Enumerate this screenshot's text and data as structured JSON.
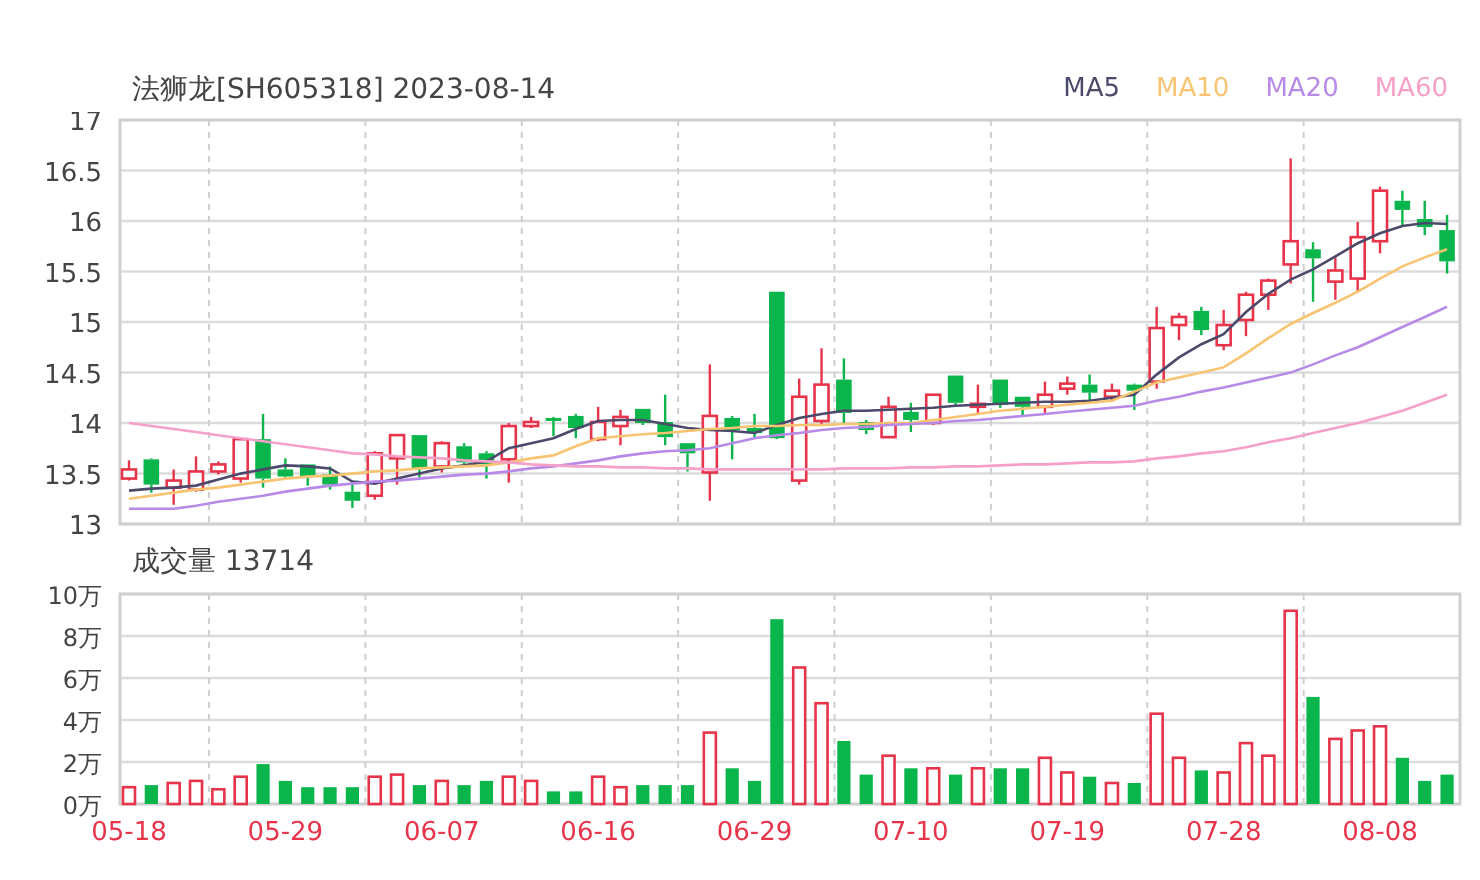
{
  "price_chart": {
    "candles": {
      "chart_data": {
        "type": "candlestick",
        "title": "法狮龙[SH605318] 2023-08-14",
        "categories": [
          null,
          null,
          null,
          null,
          null,
          null,
          null,
          null,
          null,
          null,
          null,
          null,
          null,
          null,
          null,
          null,
          null,
          null,
          null,
          null,
          null,
          null,
          null,
          null,
          null,
          null,
          null,
          null,
          null,
          null,
          null,
          null,
          null,
          null,
          null,
          null,
          null,
          null,
          null,
          null,
          null,
          null,
          null,
          null,
          null,
          null,
          null,
          null,
          null,
          null,
          null,
          null,
          null,
          null,
          null,
          null,
          null,
          null,
          null,
          null
        ],
        "grid": true,
        "ylim": [
          13,
          17
        ],
        "yticks": [
          {
            "value": 13,
            "label": "13"
          },
          {
            "value": 14,
            "label": "14"
          },
          {
            "value": 15,
            "label": "15"
          },
          {
            "value": 16,
            "label": "16"
          },
          {
            "value": 17,
            "label": "17"
          }
        ],
        "ohlc": [
          [
            13.45,
            13.63,
            13.43,
            13.54
          ],
          [
            13.64,
            13.65,
            13.31,
            13.39
          ],
          [
            13.36,
            13.54,
            13.19,
            13.43
          ],
          [
            13.34,
            13.67,
            13.32,
            13.52
          ],
          [
            13.52,
            13.62,
            13.49,
            13.59
          ],
          [
            13.45,
            13.85,
            13.41,
            13.84
          ],
          [
            13.84,
            14.09,
            13.36,
            13.45
          ],
          [
            13.54,
            13.65,
            13.45,
            13.47
          ],
          [
            13.59,
            13.59,
            13.38,
            13.47
          ],
          [
            13.49,
            13.57,
            13.34,
            13.39
          ],
          [
            13.32,
            13.43,
            13.16,
            13.23
          ],
          [
            13.28,
            13.72,
            13.24,
            13.7
          ],
          [
            13.65,
            13.88,
            13.39,
            13.88
          ],
          [
            13.88,
            13.88,
            13.46,
            13.55
          ],
          [
            13.57,
            13.82,
            13.51,
            13.8
          ],
          [
            13.77,
            13.8,
            13.57,
            13.61
          ],
          [
            13.7,
            13.72,
            13.45,
            13.59
          ],
          [
            13.64,
            14,
            13.41,
            13.97
          ],
          [
            13.97,
            14.06,
            13.95,
            14.01
          ],
          [
            14.05,
            14.06,
            13.87,
            14.03
          ],
          [
            14.07,
            14.09,
            13.85,
            13.95
          ],
          [
            13.84,
            14.16,
            13.82,
            14.01
          ],
          [
            13.97,
            14.13,
            13.78,
            14.06
          ],
          [
            14.14,
            14.14,
            13.98,
            14
          ],
          [
            14.01,
            14.28,
            13.78,
            13.86
          ],
          [
            13.8,
            13.8,
            13.52,
            13.7
          ],
          [
            13.51,
            14.58,
            13.23,
            14.07
          ],
          [
            14.05,
            14.07,
            13.64,
            13.93
          ],
          [
            13.95,
            14.09,
            13.85,
            13.9
          ],
          [
            15.3,
            15.3,
            13.84,
            13.85
          ],
          [
            13.43,
            14.44,
            13.39,
            14.26
          ],
          [
            14.02,
            14.74,
            13.99,
            14.38
          ],
          [
            14.43,
            14.64,
            14,
            14.1
          ],
          [
            14.01,
            14.03,
            13.89,
            13.93
          ],
          [
            13.86,
            14.26,
            13.85,
            14.16
          ],
          [
            14.11,
            14.2,
            13.91,
            14.03
          ],
          [
            14,
            14.28,
            13.98,
            14.28
          ],
          [
            14.47,
            14.47,
            14.16,
            14.2
          ],
          [
            14.18,
            14.38,
            14.09,
            14.19
          ],
          [
            14.43,
            14.43,
            14.15,
            14.18
          ],
          [
            14.26,
            14.26,
            14.07,
            14.16
          ],
          [
            14.16,
            14.41,
            14.09,
            14.28
          ],
          [
            14.34,
            14.46,
            14.28,
            14.39
          ],
          [
            14.38,
            14.48,
            14.2,
            14.3
          ],
          [
            14.26,
            14.39,
            14.22,
            14.32
          ],
          [
            14.38,
            14.39,
            14.13,
            14.32
          ],
          [
            14.41,
            15.15,
            14.34,
            14.94
          ],
          [
            14.97,
            15.09,
            14.82,
            15.05
          ],
          [
            15.11,
            15.15,
            14.87,
            14.92
          ],
          [
            14.77,
            15.12,
            14.72,
            14.97
          ],
          [
            15.02,
            15.3,
            14.86,
            15.27
          ],
          [
            15.27,
            15.43,
            15.12,
            15.41
          ],
          [
            15.57,
            16.62,
            15.38,
            15.8
          ],
          [
            15.72,
            15.79,
            15.2,
            15.63
          ],
          [
            15.4,
            15.64,
            15.22,
            15.51
          ],
          [
            15.43,
            15.99,
            15.3,
            15.84
          ],
          [
            15.8,
            16.34,
            15.68,
            16.3
          ],
          [
            16.2,
            16.3,
            15.95,
            16.11
          ],
          [
            16.02,
            16.2,
            15.86,
            15.94
          ],
          [
            15.91,
            16.06,
            15.48,
            15.6
          ]
        ]
      }
    },
    "moving_averages": {
      "chart_data": {
        "type": "line",
        "categories": [
          null,
          null,
          null,
          null,
          null,
          null,
          null,
          null,
          null,
          null,
          null,
          null,
          null,
          null,
          null,
          null,
          null,
          null,
          null,
          null,
          null,
          null,
          null,
          null,
          null,
          null,
          null,
          null,
          null,
          null,
          null,
          null,
          null,
          null,
          null,
          null,
          null,
          null,
          null,
          null,
          null,
          null,
          null,
          null,
          null,
          null,
          null,
          null,
          null,
          null,
          null,
          null,
          null,
          null,
          null,
          null,
          null,
          null,
          null,
          null
        ],
        "grid": true,
        "ylim": [
          13,
          17
        ],
        "yticks": [
          {
            "value": 13.5,
            "label": "13.5"
          },
          {
            "value": 14.5,
            "label": "14.5"
          },
          {
            "value": 15.5,
            "label": "15.5"
          },
          {
            "value": 16.5,
            "label": "16.5"
          }
        ],
        "series": [
          {
            "name": "MA5",
            "color": "#4b4a6b",
            "values": [
              13.33,
              13.35,
              13.36,
              13.38,
              13.44,
              13.5,
              13.54,
              13.58,
              13.57,
              13.55,
              13.42,
              13.4,
              13.45,
              13.5,
              13.55,
              13.58,
              13.62,
              13.75,
              13.8,
              13.85,
              13.94,
              14.02,
              14.03,
              14.03,
              13.99,
              13.95,
              13.93,
              13.92,
              13.9,
              13.98,
              14.05,
              14.09,
              14.12,
              14.12,
              14.13,
              14.14,
              14.15,
              14.17,
              14.18,
              14.19,
              14.2,
              14.21,
              14.21,
              14.22,
              14.25,
              14.28,
              14.48,
              14.65,
              14.78,
              14.88,
              15.1,
              15.28,
              15.42,
              15.52,
              15.65,
              15.78,
              15.88,
              15.95,
              15.98,
              15.97
            ]
          },
          {
            "name": "MA10",
            "color": "#f8c471",
            "values": [
              13.25,
              13.28,
              13.31,
              13.34,
              13.36,
              13.39,
              13.42,
              13.45,
              13.47,
              13.48,
              13.5,
              13.52,
              13.53,
              13.55,
              13.56,
              13.57,
              13.58,
              13.61,
              13.65,
              13.68,
              13.77,
              13.85,
              13.87,
              13.89,
              13.9,
              13.92,
              13.94,
              13.95,
              13.97,
              13.97,
              13.98,
              13.98,
              13.99,
              13.99,
              14,
              14,
              14.03,
              14.06,
              14.09,
              14.12,
              14.14,
              14.16,
              14.18,
              14.2,
              14.22,
              14.31,
              14.4,
              14.45,
              14.5,
              14.55,
              14.69,
              14.84,
              14.98,
              15.09,
              15.19,
              15.3,
              15.43,
              15.55,
              15.64,
              15.72
            ]
          },
          {
            "name": "MA20",
            "color": "#b88ae8",
            "values": [
              13.15,
              13.15,
              13.15,
              13.18,
              13.22,
              13.25,
              13.28,
              13.32,
              13.35,
              13.38,
              13.4,
              13.42,
              13.43,
              13.45,
              13.47,
              13.49,
              13.5,
              13.52,
              13.55,
              13.57,
              13.6,
              13.63,
              13.67,
              13.7,
              13.72,
              13.73,
              13.75,
              13.8,
              13.85,
              13.88,
              13.9,
              13.93,
              13.95,
              13.96,
              13.98,
              13.99,
              14,
              14.02,
              14.03,
              14.05,
              14.07,
              14.09,
              14.11,
              14.13,
              14.15,
              14.17,
              14.22,
              14.26,
              14.31,
              14.35,
              14.4,
              14.45,
              14.5,
              14.58,
              14.67,
              14.75,
              14.85,
              14.95,
              15.05,
              15.15
            ]
          },
          {
            "name": "MA60",
            "color": "#f5a0c8",
            "values": [
              14,
              13.97,
              13.94,
              13.91,
              13.88,
              13.85,
              13.82,
              13.79,
              13.76,
              13.73,
              13.7,
              13.69,
              13.67,
              13.66,
              13.65,
              13.63,
              13.62,
              13.61,
              13.59,
              13.58,
              13.57,
              13.57,
              13.56,
              13.56,
              13.55,
              13.55,
              13.54,
              13.54,
              13.54,
              13.54,
              13.54,
              13.54,
              13.55,
              13.55,
              13.55,
              13.56,
              13.56,
              13.57,
              13.57,
              13.58,
              13.59,
              13.59,
              13.6,
              13.61,
              13.61,
              13.62,
              13.65,
              13.67,
              13.7,
              13.72,
              13.76,
              13.81,
              13.85,
              13.9,
              13.95,
              14,
              14.06,
              14.12,
              14.2,
              14.28
            ]
          }
        ]
      }
    }
  },
  "volume_chart": {
    "chart_data": {
      "type": "bar",
      "title": "成交量 13714",
      "grid": true,
      "categories": [
        "05-18",
        null,
        null,
        null,
        null,
        null,
        null,
        "05-29",
        null,
        null,
        null,
        null,
        null,
        null,
        "06-07",
        null,
        null,
        null,
        null,
        null,
        null,
        "06-16",
        null,
        null,
        null,
        null,
        null,
        null,
        "06-29",
        null,
        null,
        null,
        null,
        null,
        null,
        "07-10",
        null,
        null,
        null,
        null,
        null,
        null,
        "07-19",
        null,
        null,
        null,
        null,
        null,
        null,
        "07-28",
        null,
        null,
        null,
        null,
        null,
        null,
        "08-08",
        null,
        null,
        null
      ],
      "ylim": [
        0,
        10
      ],
      "yticks": [
        {
          "value": 0,
          "label": "0万"
        },
        {
          "value": 2,
          "label": "2万"
        },
        {
          "value": 4,
          "label": "4万"
        },
        {
          "value": 6,
          "label": "6万"
        },
        {
          "value": 8,
          "label": "8万"
        },
        {
          "value": 10,
          "label": "10万"
        }
      ],
      "series": [
        {
          "values": [
            0.8,
            0.9,
            1,
            1.1,
            0.7,
            1.3,
            1.9,
            1.1,
            0.8,
            0.8,
            0.8,
            1.3,
            1.4,
            0.9,
            1.1,
            0.9,
            1.1,
            1.3,
            1.1,
            0.6,
            0.6,
            1.3,
            0.8,
            0.9,
            0.9,
            0.9,
            3.4,
            1.7,
            1.1,
            8.8,
            6.5,
            4.8,
            3,
            1.4,
            2.3,
            1.7,
            1.7,
            1.4,
            1.7,
            1.7,
            1.7,
            2.2,
            1.5,
            1.3,
            1,
            1,
            4.3,
            2.2,
            1.6,
            1.5,
            2.9,
            2.3,
            9.2,
            5.1,
            3.1,
            3.5,
            3.7,
            2.2,
            1.1,
            1.4
          ]
        }
      ]
    }
  }
}
